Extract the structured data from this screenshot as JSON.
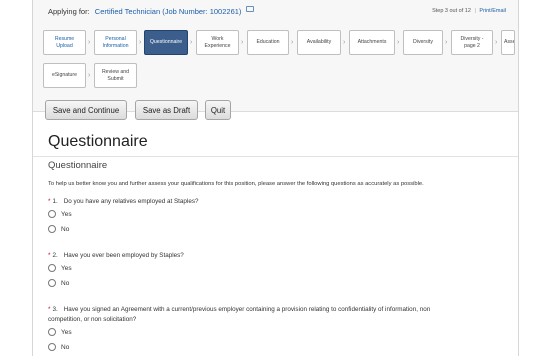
{
  "header": {
    "applying_label": "Applying for:",
    "job_title": "Certified Technician (Job Number: 1002261)",
    "step_text": "Step 3 out of 12",
    "print_link": "Print/Email"
  },
  "steps": [
    {
      "label": "Resume Upload",
      "state": "done"
    },
    {
      "label": "Personal Information",
      "state": "done"
    },
    {
      "label": "Questionnaire",
      "state": "current"
    },
    {
      "label": "Work Experience",
      "state": "todo"
    },
    {
      "label": "Education",
      "state": "todo"
    },
    {
      "label": "Availability",
      "state": "todo"
    },
    {
      "label": "Attachments",
      "state": "todo"
    },
    {
      "label": "Diversity",
      "state": "todo"
    },
    {
      "label": "Diversity - page 2",
      "state": "todo"
    },
    {
      "label": "Assessment",
      "state": "todo"
    },
    {
      "label": "eSignature",
      "state": "todo"
    },
    {
      "label": "Review and Submit",
      "state": "todo"
    }
  ],
  "buttons": {
    "save_continue": "Save and Continue",
    "save_draft": "Save as Draft",
    "quit": "Quit"
  },
  "page": {
    "title": "Questionnaire",
    "section_title": "Questionnaire",
    "intro": "To help us better know you and further assess your qualifications for this position, please answer the following questions as accurately as possible."
  },
  "questions": [
    {
      "required_mark": "*",
      "number": "1.",
      "text": "Do you have any relatives employed at Staples?",
      "options": [
        "Yes",
        "No"
      ]
    },
    {
      "required_mark": "*",
      "number": "2.",
      "text": "Have you ever been employed by Staples?",
      "options": [
        "Yes",
        "No"
      ]
    },
    {
      "required_mark": "*",
      "number": "3.",
      "text": "Have you signed an Agreement with a current/previous employer containing a provision relating to confidentiality of information, non",
      "text_line2": "competition, or non solicitation?",
      "options": [
        "Yes",
        "No"
      ]
    }
  ]
}
